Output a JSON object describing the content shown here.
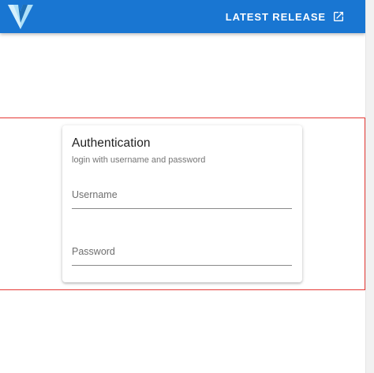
{
  "header": {
    "latest_release_label": "LATEST RELEASE",
    "logo_icon": "vuetify-logo-icon",
    "link_icon": "open-in-new-icon"
  },
  "auth_card": {
    "title": "Authentication",
    "subtitle": "login with username and password",
    "username": {
      "value": "",
      "placeholder": "Username"
    },
    "password": {
      "value": "",
      "placeholder": "Password"
    }
  },
  "colors": {
    "app_bar": "#1976d2",
    "logo_light": "#aee0f8",
    "logo_dark": "#1f6fb5",
    "highlight_border": "#e53935"
  }
}
